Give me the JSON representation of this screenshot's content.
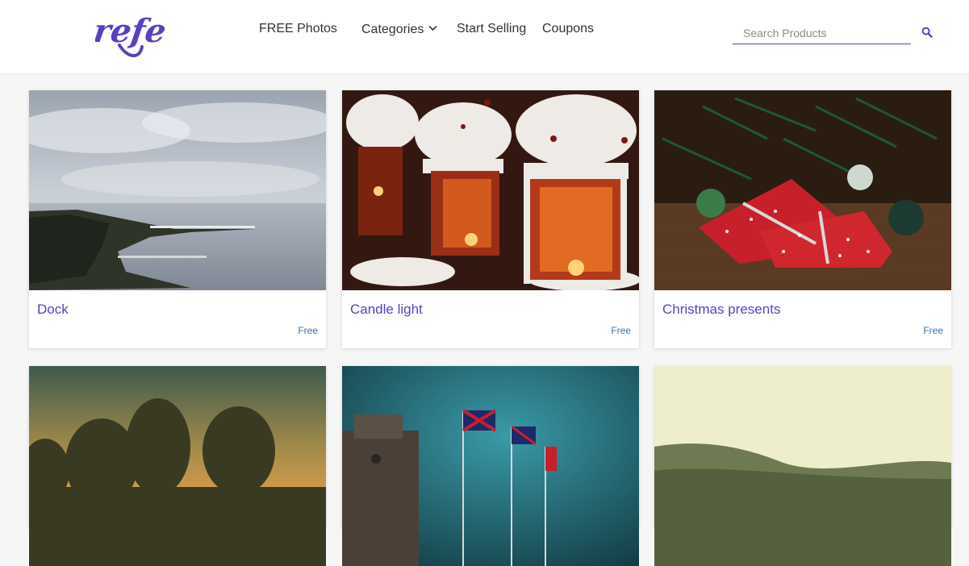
{
  "header": {
    "logo_text": "refe",
    "nav": {
      "free_photos": "FREE Photos",
      "categories": "Categories",
      "start_selling": "Start Selling",
      "coupons": "Coupons"
    },
    "search": {
      "placeholder": "Search Products",
      "value": ""
    }
  },
  "colors": {
    "accent": "#5a3fc0",
    "price": "#3b6fa8"
  },
  "products": [
    {
      "title": "Dock",
      "price": "Free"
    },
    {
      "title": "Candle light",
      "price": "Free"
    },
    {
      "title": "Christmas presents",
      "price": "Free"
    },
    {
      "title": "",
      "price": ""
    },
    {
      "title": "",
      "price": ""
    },
    {
      "title": "",
      "price": ""
    }
  ]
}
